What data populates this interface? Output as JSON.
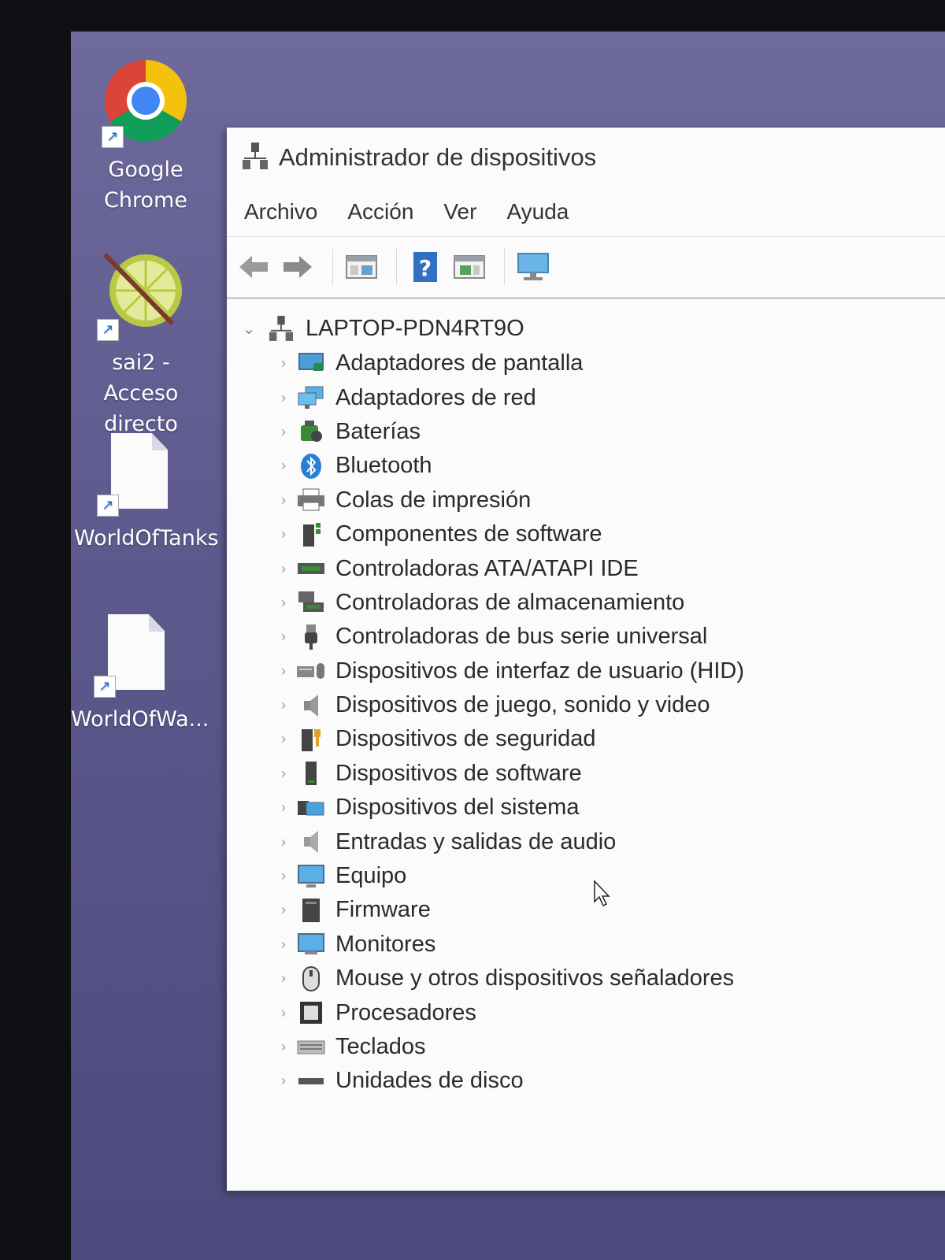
{
  "desktop": {
    "icons": [
      {
        "label_line1": "Google",
        "label_line2": "Chrome",
        "icon": "chrome-icon"
      },
      {
        "label_line1": "sai2 - Acceso",
        "label_line2": "directo",
        "icon": "sai2-icon"
      },
      {
        "label_line1": "WorldOfTanks",
        "label_line2": "",
        "icon": "file-icon"
      },
      {
        "label_line1": "WorldOfWa...",
        "label_line2": "",
        "icon": "file-icon"
      }
    ]
  },
  "window": {
    "title": "Administrador de dispositivos",
    "menu": [
      "Archivo",
      "Acción",
      "Ver",
      "Ayuda"
    ],
    "toolbar": [
      "back-arrow-icon",
      "forward-arrow-icon",
      "properties-icon",
      "help-icon",
      "update-driver-icon",
      "scan-hardware-icon"
    ],
    "tree": {
      "root": "LAPTOP-PDN4RT9O",
      "categories": [
        "Adaptadores de pantalla",
        "Adaptadores de red",
        "Baterías",
        "Bluetooth",
        "Colas de impresión",
        "Componentes de software",
        "Controladoras ATA/ATAPI IDE",
        "Controladoras de almacenamiento",
        "Controladoras de bus serie universal",
        "Dispositivos de interfaz de usuario (HID)",
        "Dispositivos de juego, sonido y video",
        "Dispositivos de seguridad",
        "Dispositivos de software",
        "Dispositivos del sistema",
        "Entradas y salidas de audio",
        "Equipo",
        "Firmware",
        "Monitores",
        "Mouse y otros dispositivos señaladores",
        "Procesadores",
        "Teclados",
        "Unidades de disco"
      ]
    }
  }
}
